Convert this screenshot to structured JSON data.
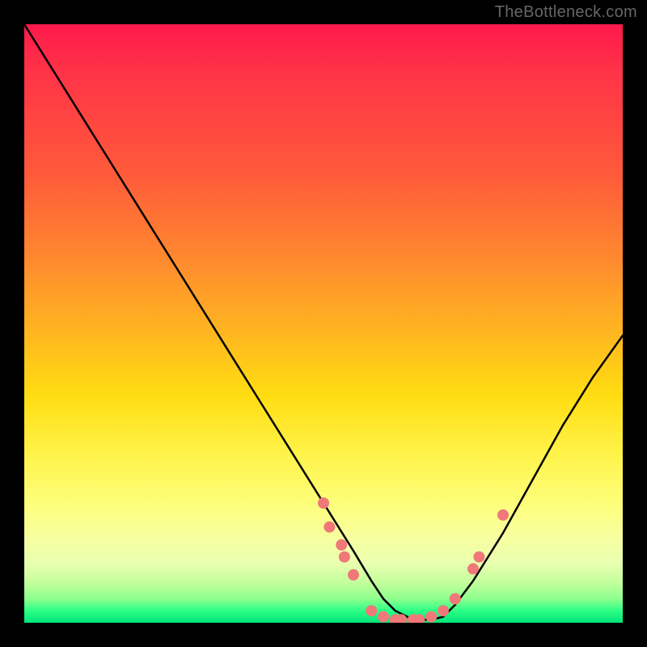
{
  "watermark": "TheBottleneck.com",
  "chart_data": {
    "type": "line",
    "title": "",
    "xlabel": "",
    "ylabel": "",
    "xlim": [
      0,
      100
    ],
    "ylim": [
      0,
      100
    ],
    "grid": false,
    "legend": false,
    "series": [
      {
        "name": "curve",
        "x": [
          0,
          5,
          10,
          15,
          20,
          25,
          30,
          35,
          40,
          45,
          50,
          55,
          58,
          60,
          62,
          65,
          68,
          70,
          72,
          75,
          80,
          85,
          90,
          95,
          100
        ],
        "y": [
          100,
          92,
          84,
          76,
          68,
          60,
          52,
          44,
          36,
          28,
          20,
          12,
          7,
          4,
          2,
          0.5,
          0.5,
          1,
          3,
          7,
          15,
          24,
          33,
          41,
          48
        ]
      }
    ],
    "markers": [
      {
        "x": 50,
        "y": 20
      },
      {
        "x": 51,
        "y": 16
      },
      {
        "x": 53,
        "y": 13
      },
      {
        "x": 53.5,
        "y": 11
      },
      {
        "x": 55,
        "y": 8
      },
      {
        "x": 58,
        "y": 2
      },
      {
        "x": 60,
        "y": 1
      },
      {
        "x": 62,
        "y": 0.5
      },
      {
        "x": 63,
        "y": 0.5
      },
      {
        "x": 65,
        "y": 0.5
      },
      {
        "x": 66,
        "y": 0.5
      },
      {
        "x": 68,
        "y": 1
      },
      {
        "x": 70,
        "y": 2
      },
      {
        "x": 72,
        "y": 4
      },
      {
        "x": 75,
        "y": 9
      },
      {
        "x": 76,
        "y": 11
      },
      {
        "x": 80,
        "y": 18
      }
    ],
    "colors": {
      "curve": "#000000",
      "marker": "#f07878",
      "gradient_top": "#ff1a4d",
      "gradient_bottom": "#00e57a"
    }
  }
}
